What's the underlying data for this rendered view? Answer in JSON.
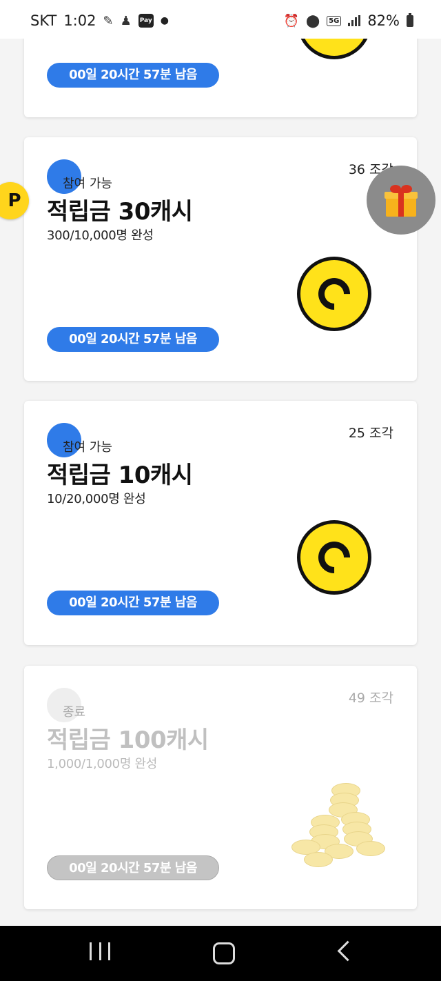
{
  "status_bar": {
    "carrier": "SKT",
    "time": "1:02",
    "pay_label": "Pay",
    "network": "5G",
    "battery": "82%"
  },
  "cards": [
    {
      "timer": "00일 20시간 57분 남음"
    },
    {
      "status": "참여 가능",
      "pieces": "36 조각",
      "title": "적립금 30캐시",
      "progress": "300/10,000명 완성",
      "timer": "00일 20시간 57분 남음"
    },
    {
      "status": "참여 가능",
      "pieces": "25 조각",
      "title": "적립금 10캐시",
      "progress": "10/20,000명 완성",
      "timer": "00일 20시간 57분 남음"
    },
    {
      "status": "종료",
      "pieces": "49 조각",
      "title": "적립금 100캐시",
      "progress": "1,000/1,000명 완성",
      "timer": "00일 20시간 57분 남음"
    }
  ],
  "floating": {
    "point_label": "P"
  },
  "colors": {
    "accent": "#2f7be8",
    "coin": "#ffe21a",
    "ended": "#c4c4c4"
  }
}
